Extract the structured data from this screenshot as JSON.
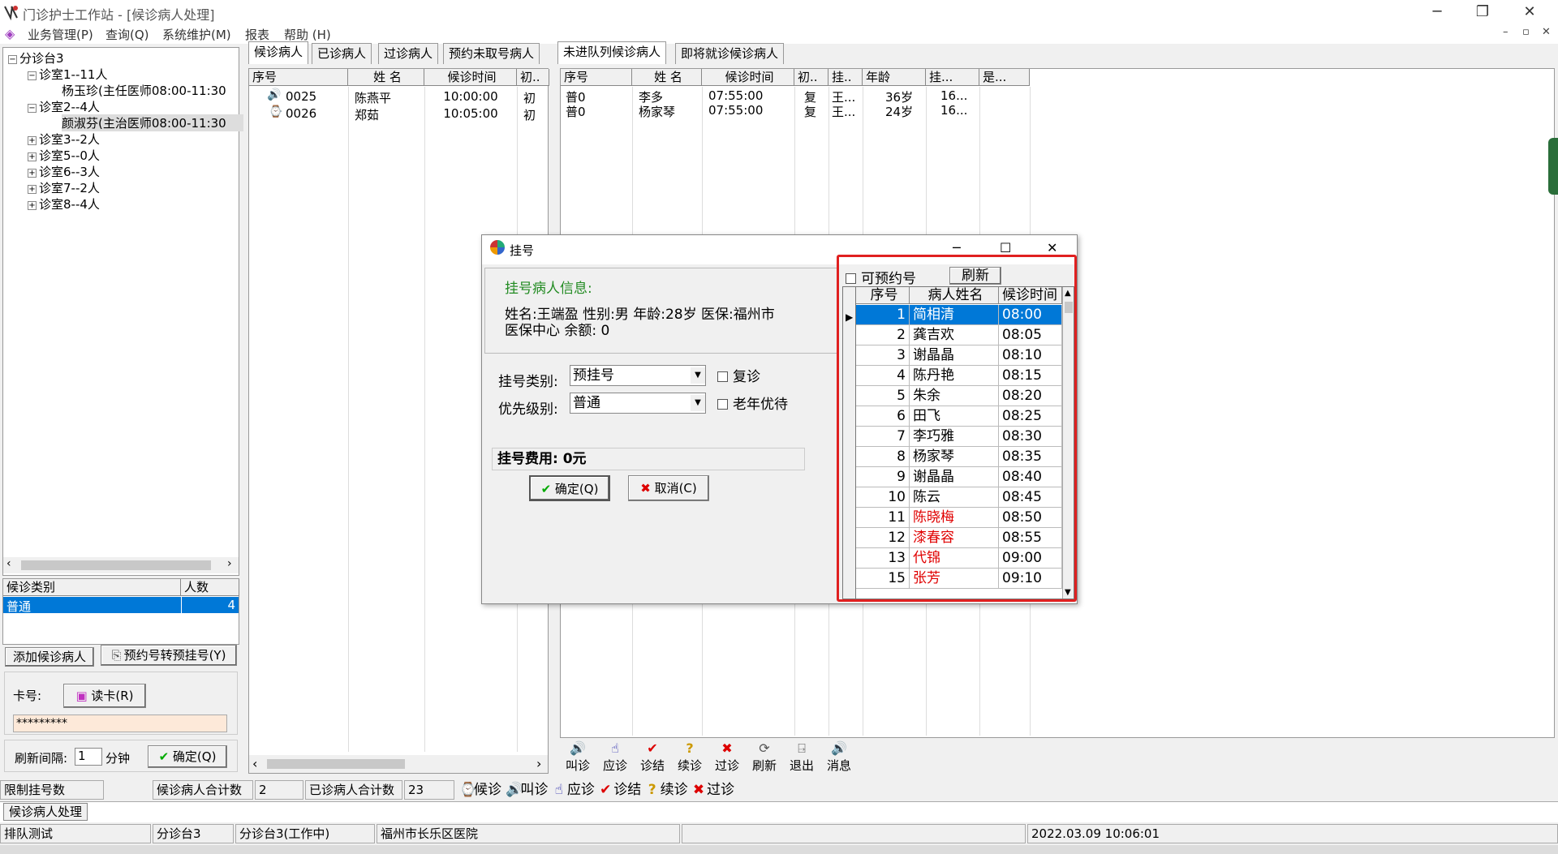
{
  "window": {
    "title": "门诊护士工作站 - [候诊病人处理]",
    "minimize": "─",
    "restore": "❐",
    "close": "✕"
  },
  "menu": {
    "items": [
      "业务管理(P)",
      "查询(Q)",
      "系统维护(M)",
      "报表",
      "帮助 (H)"
    ],
    "mdi": [
      "–",
      "▫",
      "✕"
    ]
  },
  "tree": {
    "root": "分诊台3",
    "nodes": [
      {
        "label": "诊室1--11人",
        "expanded": true,
        "children": [
          "杨玉珍(主任医师08:00-11:30"
        ]
      },
      {
        "label": "诊室2--4人",
        "expanded": true,
        "children": [
          "颜淑芬(主治医师08:00-11:30"
        ]
      },
      {
        "label": "诊室3--2人",
        "expanded": false
      },
      {
        "label": "诊室5--0人",
        "expanded": false
      },
      {
        "label": "诊室6--3人",
        "expanded": false
      },
      {
        "label": "诊室7--2人",
        "expanded": false
      },
      {
        "label": "诊室8--4人",
        "expanded": false
      }
    ]
  },
  "category_table": {
    "headers": [
      "候诊类别",
      "人数"
    ],
    "rows": [
      [
        "普通",
        "4"
      ]
    ]
  },
  "left_buttons": {
    "add_waiting": "添加候诊病人",
    "convert": "预约号转预挂号(Y)"
  },
  "card": {
    "label": "卡号:",
    "read_btn": "读卡(R)",
    "value": "*********"
  },
  "refresh": {
    "label": "刷新间隔:",
    "value": "1",
    "unit": "分钟",
    "ok_btn": "确定(Q)"
  },
  "mid_tabs": [
    "候诊病人",
    "已诊病人",
    "过诊病人",
    "预约未取号病人"
  ],
  "mid_table": {
    "headers": [
      "序号",
      "姓  名",
      "候诊时间",
      "初.."
    ],
    "rows": [
      [
        "0025",
        "陈燕平",
        "10:00:00",
        "初"
      ],
      [
        "0026",
        "郑茹",
        "10:05:00",
        "初"
      ]
    ]
  },
  "right_tabs": [
    "未进队列候诊病人",
    "即将就诊候诊病人"
  ],
  "right_table": {
    "headers": [
      "序号",
      "姓  名",
      "候诊时间",
      "初..",
      "挂..",
      "年龄",
      "挂...",
      "是..."
    ],
    "rows": [
      [
        "普0",
        "李多",
        "07:55:00",
        "复",
        "王...",
        "36岁",
        "16..."
      ],
      [
        "普0",
        "杨家琴",
        "07:55:00",
        "复",
        "王...",
        "24岁",
        "16..."
      ]
    ]
  },
  "toolbar": [
    "叫诊",
    "应诊",
    "诊结",
    "续诊",
    "过诊",
    "刷新",
    "退出",
    "消息"
  ],
  "status1": {
    "limit": "限制挂号数",
    "waiting_label": "候诊病人合计数",
    "waiting_value": "2",
    "seen_label": "已诊病人合计数",
    "seen_value": "23",
    "legend": [
      "候诊",
      "叫诊",
      "应诊",
      "诊结",
      "续诊",
      "过诊"
    ]
  },
  "bottom_tab": "候诊病人处理",
  "status2": [
    "排队测试",
    "分诊台3",
    "分诊台3(工作中)",
    "福州市长乐区医院",
    "",
    "2022.03.09 10:06:01"
  ],
  "dialog": {
    "title": "挂号",
    "info_title": "挂号病人信息:",
    "info_line1": "姓名:王端盈 性别:男 年龄:28岁 医保:福州市",
    "info_line2": "医保中心 余额: 0",
    "type_label": "挂号类别:",
    "type_value": "预挂号",
    "revisit": "复诊",
    "priority_label": "优先级别:",
    "priority_value": "普通",
    "elder": "老年优待",
    "fee": "挂号费用: 0元",
    "ok": "确定(Q)",
    "cancel": "取消(C)",
    "appt_check": "可预约号",
    "refresh": "刷新",
    "grid_headers": [
      "序号",
      "病人姓名",
      "候诊时间"
    ],
    "grid_rows": [
      {
        "no": "1",
        "name": "简相清",
        "time": "08:00",
        "red": false,
        "selected": true
      },
      {
        "no": "2",
        "name": "龚吉欢",
        "time": "08:05",
        "red": false
      },
      {
        "no": "3",
        "name": "谢晶晶",
        "time": "08:10",
        "red": false
      },
      {
        "no": "4",
        "name": "陈丹艳",
        "time": "08:15",
        "red": false
      },
      {
        "no": "5",
        "name": "朱余",
        "time": "08:20",
        "red": false
      },
      {
        "no": "6",
        "name": "田飞",
        "time": "08:25",
        "red": false
      },
      {
        "no": "7",
        "name": "李巧雅",
        "time": "08:30",
        "red": false
      },
      {
        "no": "8",
        "name": "杨家琴",
        "time": "08:35",
        "red": false
      },
      {
        "no": "9",
        "name": "谢晶晶",
        "time": "08:40",
        "red": false
      },
      {
        "no": "10",
        "name": "陈云",
        "time": "08:45",
        "red": false
      },
      {
        "no": "11",
        "name": "陈晓梅",
        "time": "08:50",
        "red": true
      },
      {
        "no": "12",
        "name": "漆春容",
        "time": "08:55",
        "red": true
      },
      {
        "no": "13",
        "name": "代锦",
        "time": "09:00",
        "red": true
      },
      {
        "no": "15",
        "name": "张芳",
        "time": "09:10",
        "red": true
      }
    ]
  },
  "colors": {
    "selection": "#0078d7",
    "highlight_box": "#e02020",
    "red_text": "#e00000",
    "green_title": "#228b22"
  }
}
